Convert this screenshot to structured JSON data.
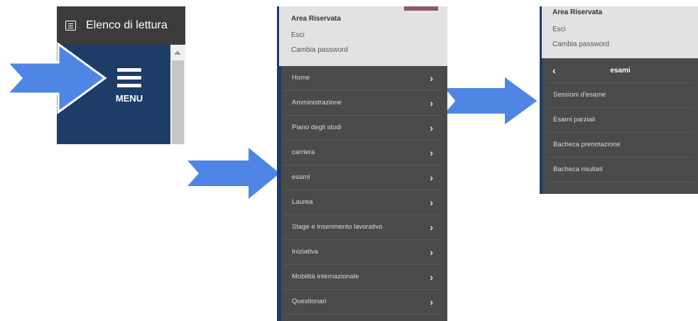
{
  "panel1": {
    "toolbar_label": "Elenco di lettura",
    "menu_label": "MENU",
    "colors": {
      "menu_bg": "#1d3c68",
      "toolbar_bg": "#3b3b3b"
    }
  },
  "panel2": {
    "area_title": "Area Riservata",
    "links": [
      "Esci",
      "Cambia password"
    ],
    "nav_items": [
      "Home",
      "Amministrazione",
      "Piano degli studi",
      "carriera",
      "esami",
      "Laurea",
      "Stage e inserimento lavorativo",
      "Iniziativa",
      "Mobilità internazionale",
      "Questionari"
    ]
  },
  "panel3": {
    "area_title": "Area Riservata",
    "links": [
      "Esci",
      "Cambia password"
    ],
    "submenu_title": "esami",
    "sub_items": [
      "Sessioni d'esame",
      "Esami parziali",
      "Bacheca prenotazione",
      "Bacheca risultati"
    ]
  },
  "icons": [
    "list-icon",
    "hamburger-icon",
    "chevron-right-icon",
    "chevron-left-icon",
    "arrow-right-icon"
  ],
  "colors": {
    "arrow": "#4f86e6",
    "menu_dark": "#4a4a4a",
    "area_bg": "#e2e2e2"
  }
}
